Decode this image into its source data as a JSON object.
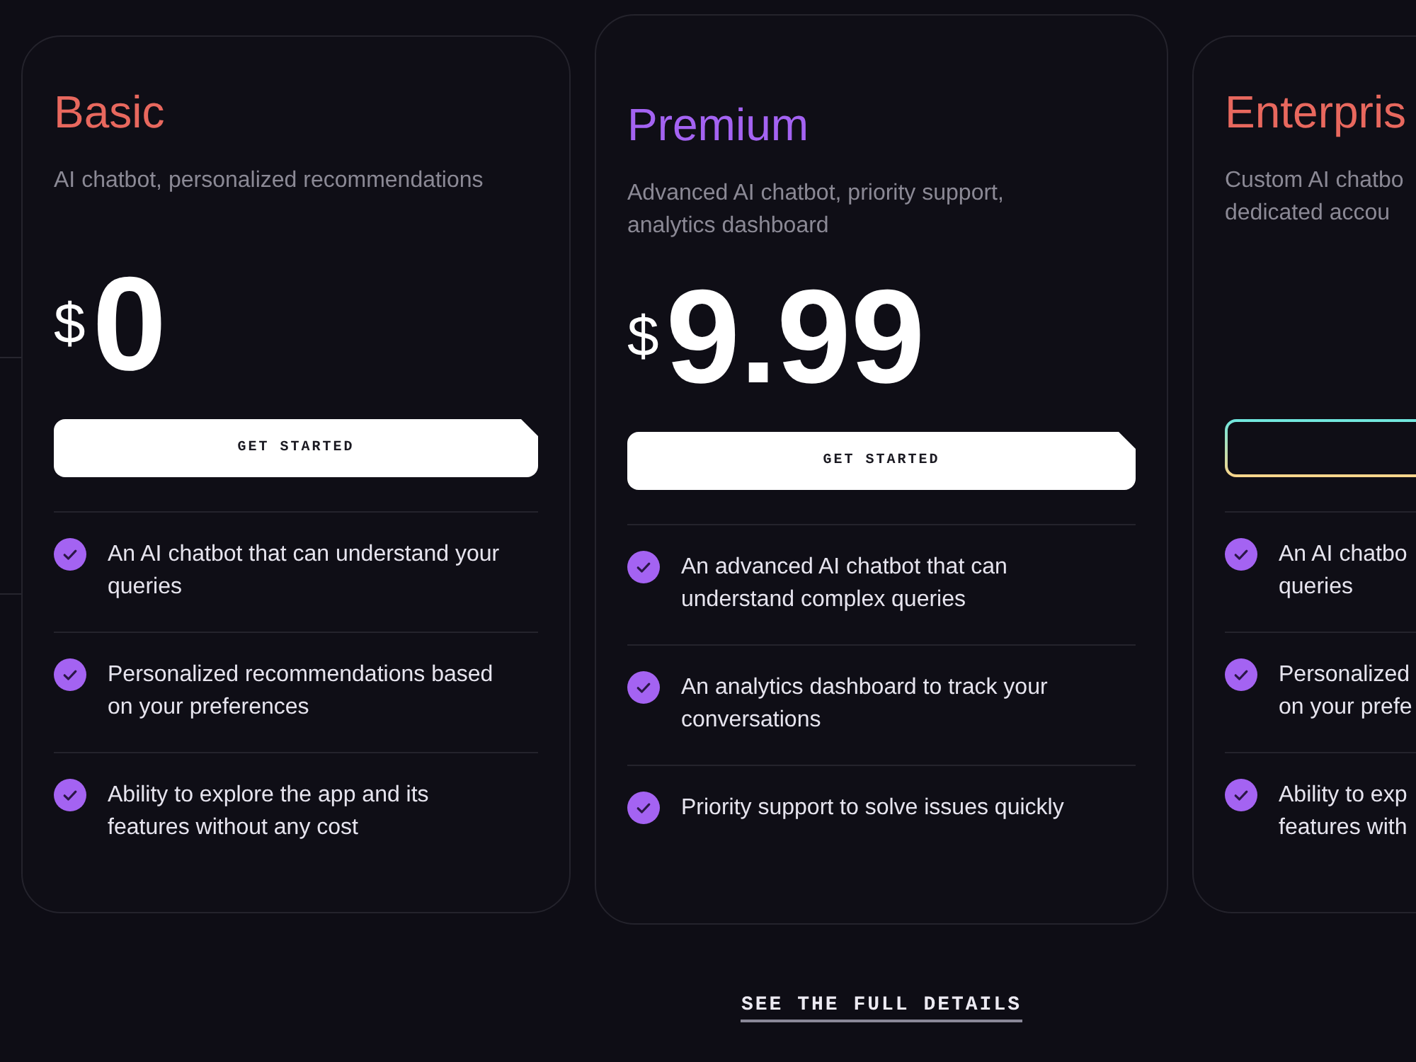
{
  "plans": [
    {
      "name": "Basic",
      "color": "#e8685e",
      "featured": false,
      "cut_off": false,
      "description": [
        "AI chatbot, personalized recommendations"
      ],
      "price": {
        "currency": "$",
        "amount": "0"
      },
      "button": {
        "kind": "solid",
        "label": "GET STARTED"
      },
      "features": [
        {
          "lines": [
            "An AI chatbot that can understand your",
            "queries"
          ]
        },
        {
          "lines": [
            "Personalized recommendations based",
            "on your preferences"
          ]
        },
        {
          "lines": [
            "Ability to explore the app and its",
            "features without any cost"
          ]
        }
      ]
    },
    {
      "name": "Premium",
      "color": "#a463f2",
      "featured": true,
      "cut_off": false,
      "description": [
        "Advanced AI chatbot, priority support,",
        "analytics dashboard"
      ],
      "price": {
        "currency": "$",
        "amount": "9.99"
      },
      "button": {
        "kind": "solid",
        "label": "GET STARTED"
      },
      "features": [
        {
          "lines": [
            "An advanced AI chatbot that can",
            "understand complex queries"
          ]
        },
        {
          "lines": [
            "An analytics dashboard to track your",
            "conversations"
          ]
        },
        {
          "lines": [
            "Priority support to solve issues quickly"
          ]
        }
      ]
    },
    {
      "name": "Enterpris",
      "color": "#e8685e",
      "featured": false,
      "cut_off": true,
      "description": [
        "Custom AI chatbo",
        "dedicated accou"
      ],
      "button": {
        "kind": "outline"
      },
      "features": [
        {
          "lines": [
            "An AI chatbo",
            "queries"
          ]
        },
        {
          "lines": [
            "Personalized",
            "on your prefe"
          ]
        },
        {
          "lines": [
            "Ability to exp",
            "features with"
          ]
        }
      ]
    }
  ],
  "details_link": "SEE THE FULL DETAILS"
}
